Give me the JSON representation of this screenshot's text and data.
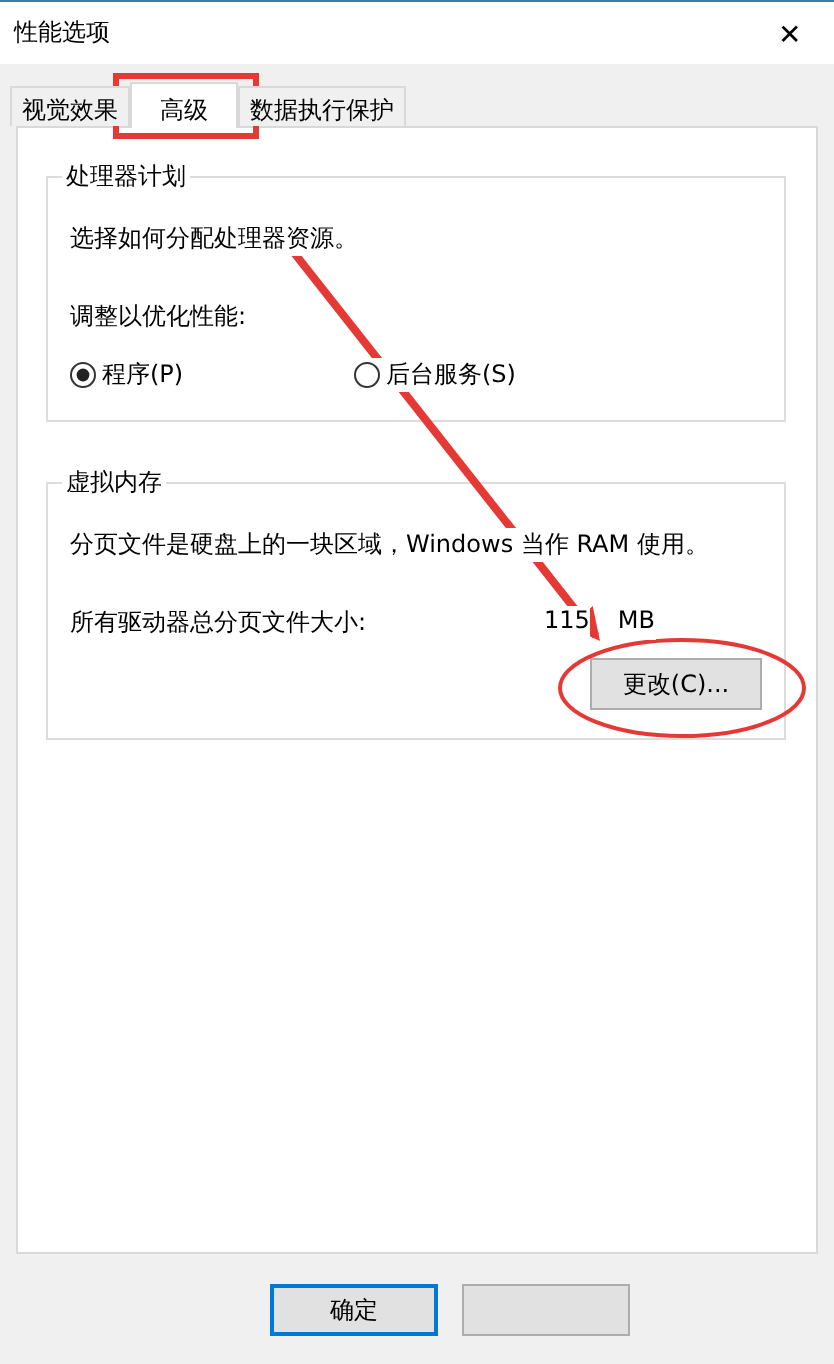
{
  "window": {
    "title": "性能选项",
    "close": "✕"
  },
  "tabs": [
    {
      "label": "视觉效果",
      "selected": false
    },
    {
      "label": "高级",
      "selected": true
    },
    {
      "label": "数据执行保护",
      "selected": false
    }
  ],
  "processor_group": {
    "title": "处理器计划",
    "description": "选择如何分配处理器资源。",
    "prompt": "调整以优化性能:",
    "options": [
      {
        "label": "程序(P)",
        "selected": true
      },
      {
        "label": "后台服务(S)",
        "selected": false
      }
    ]
  },
  "memory_group": {
    "title": "虚拟内存",
    "description": "分页文件是硬盘上的一块区域，Windows 当作 RAM 使用。",
    "size_label": "所有驱动器总分页文件大小:",
    "size_value": "115",
    "size_unit": "MB",
    "button": "更改(C)..."
  },
  "buttons": [
    {
      "label": "确定",
      "default": true
    },
    {
      "default": false
    }
  ],
  "annotations": [
    {
      "kind": "box"
    },
    {
      "kind": "arrow"
    },
    {
      "kind": "ellipse"
    }
  ]
}
